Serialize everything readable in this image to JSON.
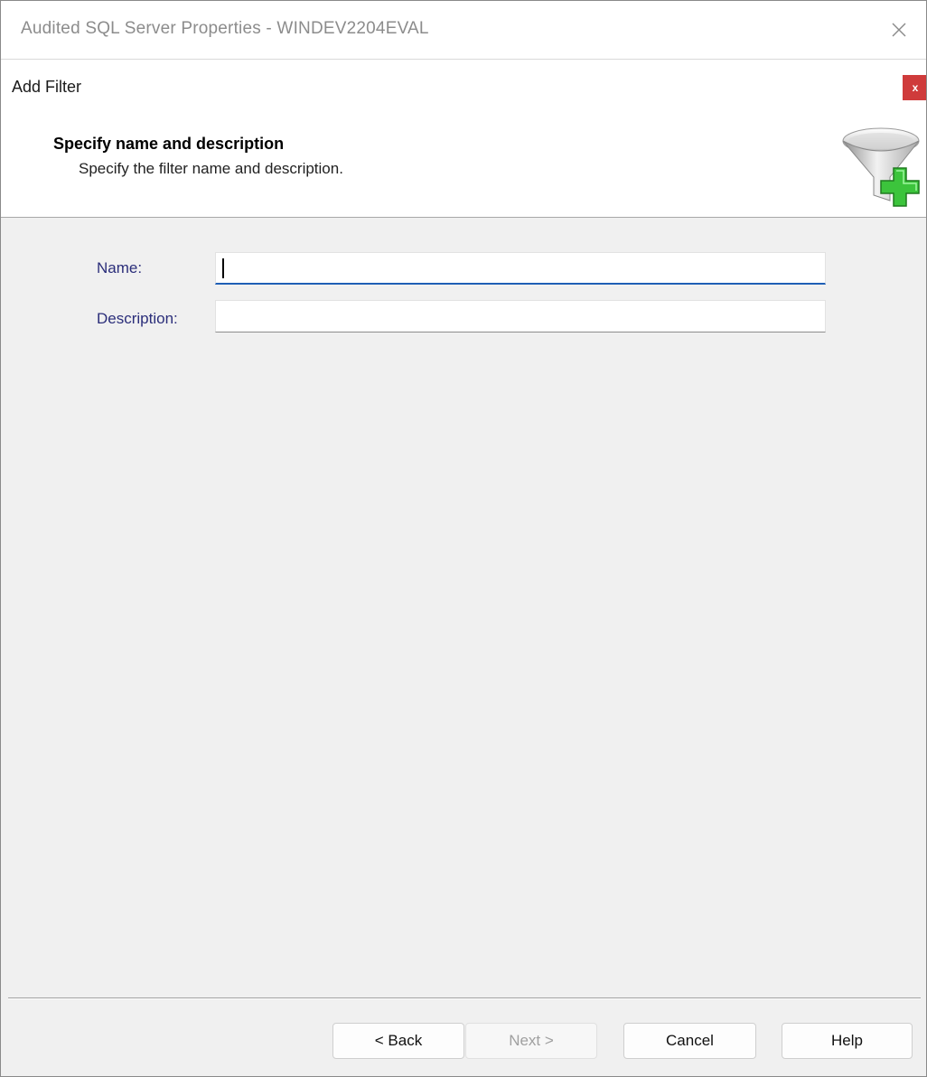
{
  "window": {
    "title": "Audited SQL Server Properties - WINDEV2204EVAL"
  },
  "dialog": {
    "title": "Add Filter",
    "close_label": "x"
  },
  "banner": {
    "heading": "Specify name and description",
    "subheading": "Specify the filter name and description.",
    "icon": "funnel-add-icon"
  },
  "form": {
    "name_label": "Name:",
    "name_value": "",
    "description_label": "Description:",
    "description_value": ""
  },
  "buttons": {
    "back": "< Back",
    "next": "Next >",
    "cancel": "Cancel",
    "help": "Help"
  },
  "colors": {
    "label_text": "#2b2e7a",
    "focus_underline": "#1f5fb5",
    "dialog_close_bg": "#cf3b3b",
    "funnel_plus": "#3cc43c"
  }
}
